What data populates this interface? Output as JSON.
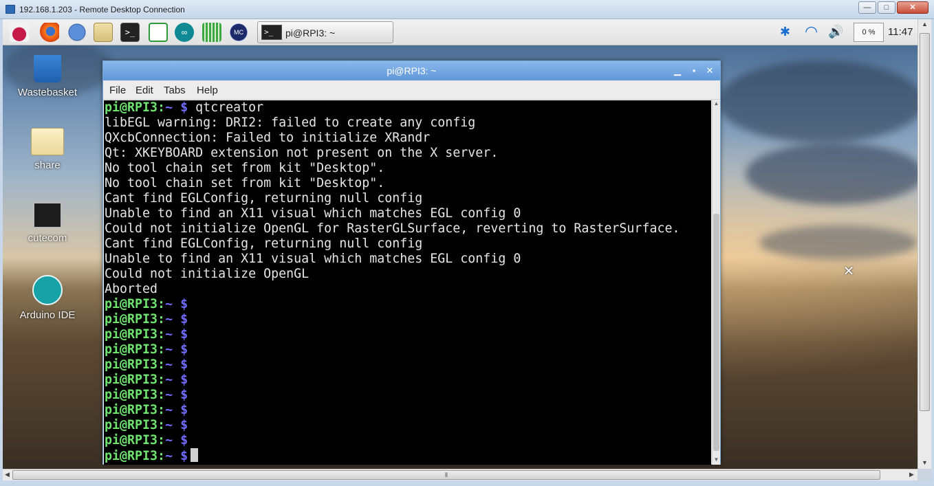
{
  "rdp": {
    "title": "192.168.1.203 - Remote Desktop Connection",
    "minimize": "—",
    "maximize": "□",
    "close": "✕",
    "hscroll_grip": "⦀"
  },
  "taskbar": {
    "launchers": [
      "raspberry-menu-icon",
      "firefox-icon",
      "web-browser-icon",
      "file-manager-icon",
      "terminal-icon",
      "spreadsheet-icon",
      "arduino-icon",
      "equalizer-icon",
      "mc-icon"
    ],
    "task_label": "pi@RPI3: ~",
    "task_icon_text": ">_",
    "cpu": "0 %",
    "clock": "11:47",
    "tray": {
      "bluetooth": "✱",
      "wifi": "◠",
      "volume": "🔊"
    }
  },
  "desktop_icons": [
    {
      "label": "Wastebasket"
    },
    {
      "label": "share"
    },
    {
      "label": "cutecom"
    },
    {
      "label": "Arduino IDE"
    }
  ],
  "terminal": {
    "title": "pi@RPI3: ~",
    "menu": [
      "File",
      "Edit",
      "Tabs",
      "Help"
    ],
    "prompt_user": "pi@RPI3",
    "prompt_sep": ":",
    "prompt_path": "~ $",
    "command": " qtcreator",
    "output": [
      "libEGL warning: DRI2: failed to create any config",
      "QXcbConnection: Failed to initialize XRandr",
      "Qt: XKEYBOARD extension not present on the X server.",
      "No tool chain set from kit \"Desktop\".",
      "No tool chain set from kit \"Desktop\".",
      "Cant find EGLConfig, returning null config",
      "Unable to find an X11 visual which matches EGL config 0",
      "Could not initialize OpenGL for RasterGLSurface, reverting to RasterSurface.",
      "Cant find EGLConfig, returning null config",
      "Unable to find an X11 visual which matches EGL config 0",
      "Could not initialize OpenGL",
      "Aborted"
    ],
    "empty_prompt_count": 11
  },
  "colors": {
    "prompt_user": "#6ee36e",
    "prompt_path": "#6f6cff",
    "terminal_bg": "#000000",
    "titlebar": "#6aa3e0"
  }
}
